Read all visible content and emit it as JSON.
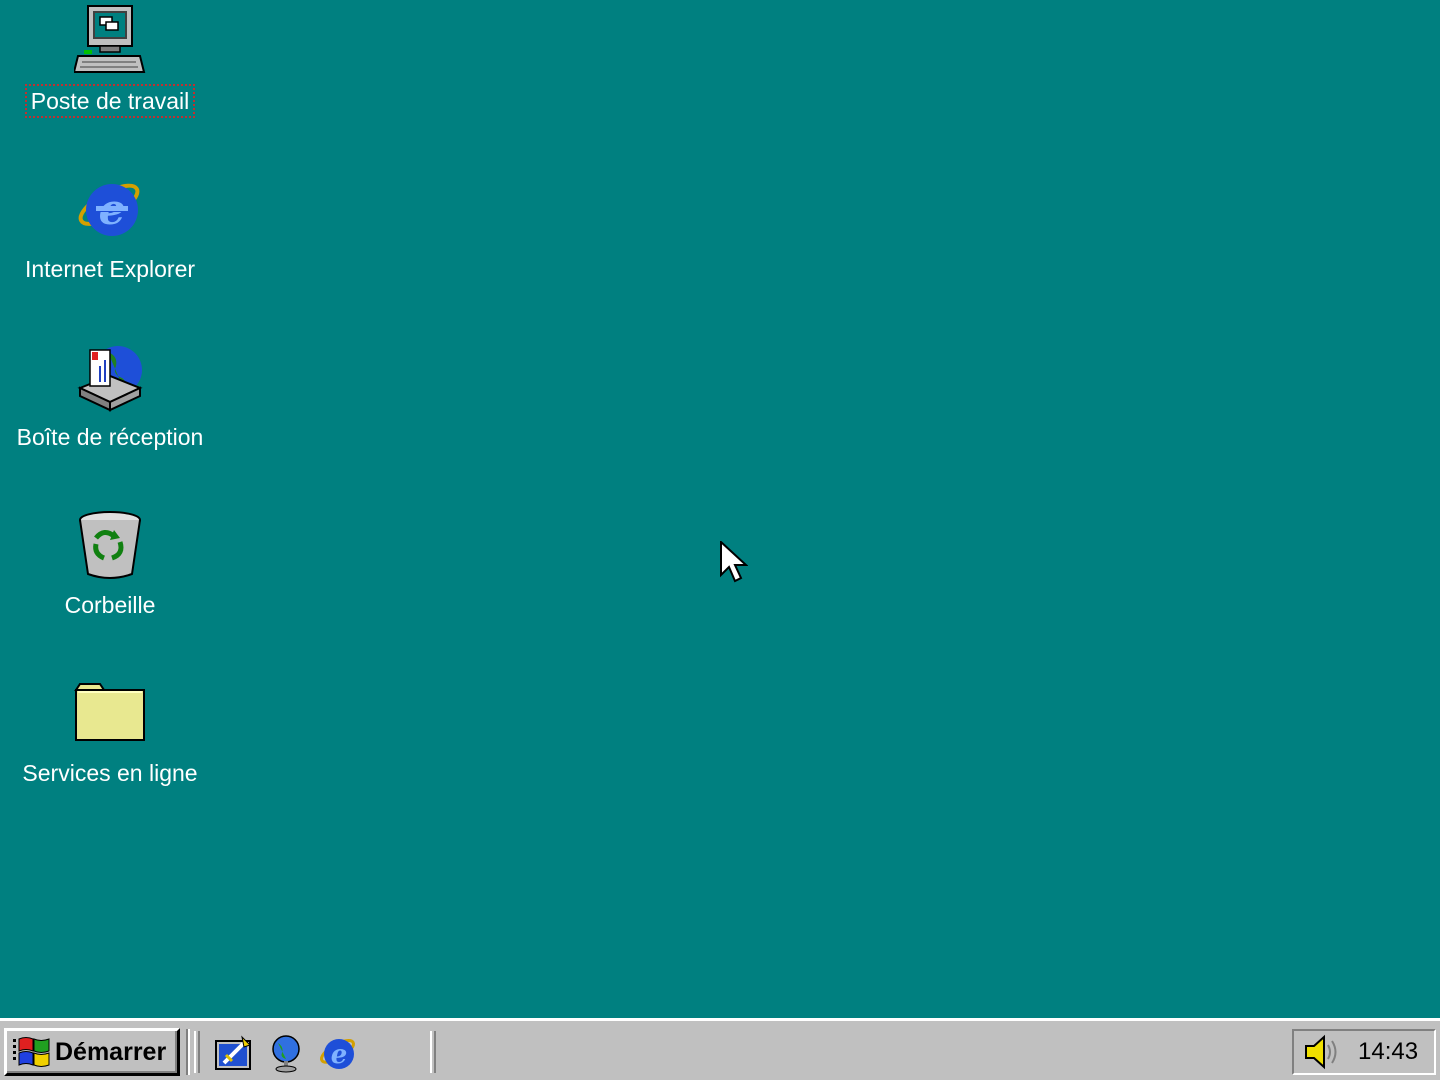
{
  "desktop": {
    "background_color": "#008080",
    "icons": [
      {
        "label": "Poste de travail",
        "icon": "my-computer-icon"
      },
      {
        "label": "Internet Explorer",
        "icon": "internet-explorer-icon"
      },
      {
        "label": "Boîte de réception",
        "icon": "inbox-icon"
      },
      {
        "label": "Corbeille",
        "icon": "recycle-bin-icon"
      },
      {
        "label": "Services en ligne",
        "icon": "folder-icon"
      }
    ]
  },
  "taskbar": {
    "start_label": "Démarrer",
    "quick_launch": [
      "show-desktop-icon",
      "channels-icon",
      "internet-explorer-icon"
    ],
    "tray": {
      "icons": [
        "speaker-icon"
      ],
      "clock": "14:43"
    }
  }
}
